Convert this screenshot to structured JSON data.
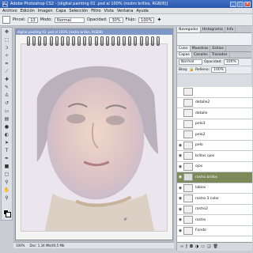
{
  "app": {
    "title": "Adobe Photoshop CS2 - [digital painting 01 .psd al 100% (rostro brillos, RGB/8)]"
  },
  "menu": [
    "Archivo",
    "Edición",
    "Imagen",
    "Capa",
    "Selección",
    "Filtro",
    "Vista",
    "Ventana",
    "Ayuda"
  ],
  "options": {
    "pincel_label": "Pincel:",
    "pincel_size": "13",
    "modo_label": "Modo:",
    "modo_value": "Normal",
    "opacidad_label": "Opacidad:",
    "opacidad_value": "30%",
    "flujo_label": "Flujo:",
    "flujo_value": "100%"
  },
  "document": {
    "tab": "digital painting 01 .psd al 100% (rostro brillos, RGB/8)"
  },
  "status": {
    "zoom": "100%",
    "doc": "Doc: 1,34 Mb/40,5 Mb"
  },
  "panels": {
    "tabs_top": [
      "Navegador",
      "Histograma",
      "Info"
    ],
    "tabs_mid": [
      "Color",
      "Muestras",
      "Estilos"
    ],
    "tabs_layers": [
      "Capas",
      "Canales",
      "Trazados"
    ],
    "blend_mode": "Normal",
    "opacity_label": "Opacidad:",
    "opacity_value": "100%",
    "lock_label": "Bloq:",
    "fill_label": "Relleno:",
    "fill_value": "100%",
    "layers": [
      {
        "name": "",
        "visible": false,
        "selected": false
      },
      {
        "name": "detalle2",
        "visible": false,
        "selected": false
      },
      {
        "name": "detalle",
        "visible": false,
        "selected": false
      },
      {
        "name": "pelo3",
        "visible": false,
        "selected": false
      },
      {
        "name": "pelo2",
        "visible": false,
        "selected": false
      },
      {
        "name": "pelo",
        "visible": true,
        "selected": false
      },
      {
        "name": "brillos ojos",
        "visible": true,
        "selected": false
      },
      {
        "name": "ojos",
        "visible": true,
        "selected": false
      },
      {
        "name": "rostro brillos",
        "visible": true,
        "selected": true
      },
      {
        "name": "labios",
        "visible": true,
        "selected": false
      },
      {
        "name": "rostro 3 color",
        "visible": true,
        "selected": false
      },
      {
        "name": "rostro2",
        "visible": true,
        "selected": false
      },
      {
        "name": "rostro",
        "visible": true,
        "selected": false
      },
      {
        "name": "Fondo",
        "visible": true,
        "selected": false
      }
    ]
  },
  "colors": {
    "title_bar": "#2f5fb5",
    "selected_layer": "#7b8a58"
  }
}
